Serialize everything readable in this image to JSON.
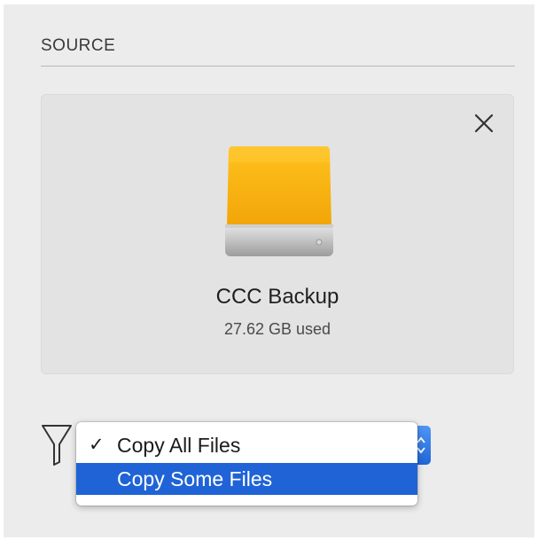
{
  "source_panel": {
    "title": "SOURCE",
    "close_icon": "close-icon",
    "volume": {
      "icon": "hard-drive-icon",
      "name": "CCC Backup",
      "usage": "27.62 GB used",
      "icon_color": "#f4b20d"
    }
  },
  "filter": {
    "icon": "funnel-filter-icon",
    "popup": {
      "options": [
        {
          "label": "Copy All Files",
          "checked": true,
          "highlighted": false
        },
        {
          "label": "Copy Some Files",
          "checked": false,
          "highlighted": true
        }
      ],
      "check_mark": "✓",
      "highlight_color": "#1f63d6"
    }
  }
}
